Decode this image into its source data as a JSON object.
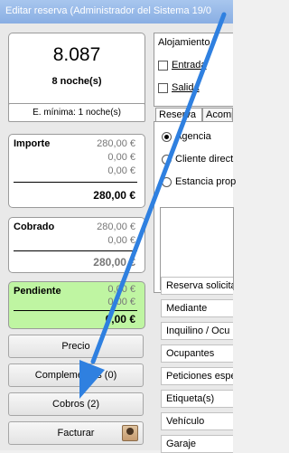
{
  "window": {
    "title": "Editar reserva  (Administrador del Sistema 19/0"
  },
  "summary": {
    "total_amount": "8.087",
    "nights": "8 noche(s)",
    "min_stay": "E. mínima: 1 noche(s)"
  },
  "importe": {
    "label": "Importe",
    "lines": [
      "280,00 €",
      "0,00 €",
      "0,00 €"
    ],
    "total": "280,00 €"
  },
  "cobrado": {
    "label": "Cobrado",
    "lines": [
      "280,00 €",
      "0,00 €"
    ],
    "total": "280,00 €"
  },
  "pendiente": {
    "label": "Pendiente",
    "lines": [
      "0,00 €",
      "0,00 €"
    ],
    "total": "0,00 €"
  },
  "buttons": {
    "precio": "Precio",
    "complementos": "Complementos (0)",
    "cobros": "Cobros (2)",
    "facturar": "Facturar"
  },
  "alojamiento": {
    "title": "Alojamiento",
    "entrada": "Entrada",
    "salida": "Salida"
  },
  "tabs": [
    "Reserva",
    "Acomp"
  ],
  "reserva_tab": {
    "options": [
      "Agencia",
      "Cliente direct",
      "Estancia prop"
    ],
    "selected": "Agencia"
  },
  "fields": [
    "Reserva solicitad",
    "Mediante",
    "Inquilino / Ocu",
    "Ocupantes",
    "Peticiones espe",
    "Etiqueta(s)",
    "Vehículo",
    "Garaje"
  ],
  "colors": {
    "pendiente_bg": "#bff5a2",
    "arrow": "#2f80e0"
  }
}
